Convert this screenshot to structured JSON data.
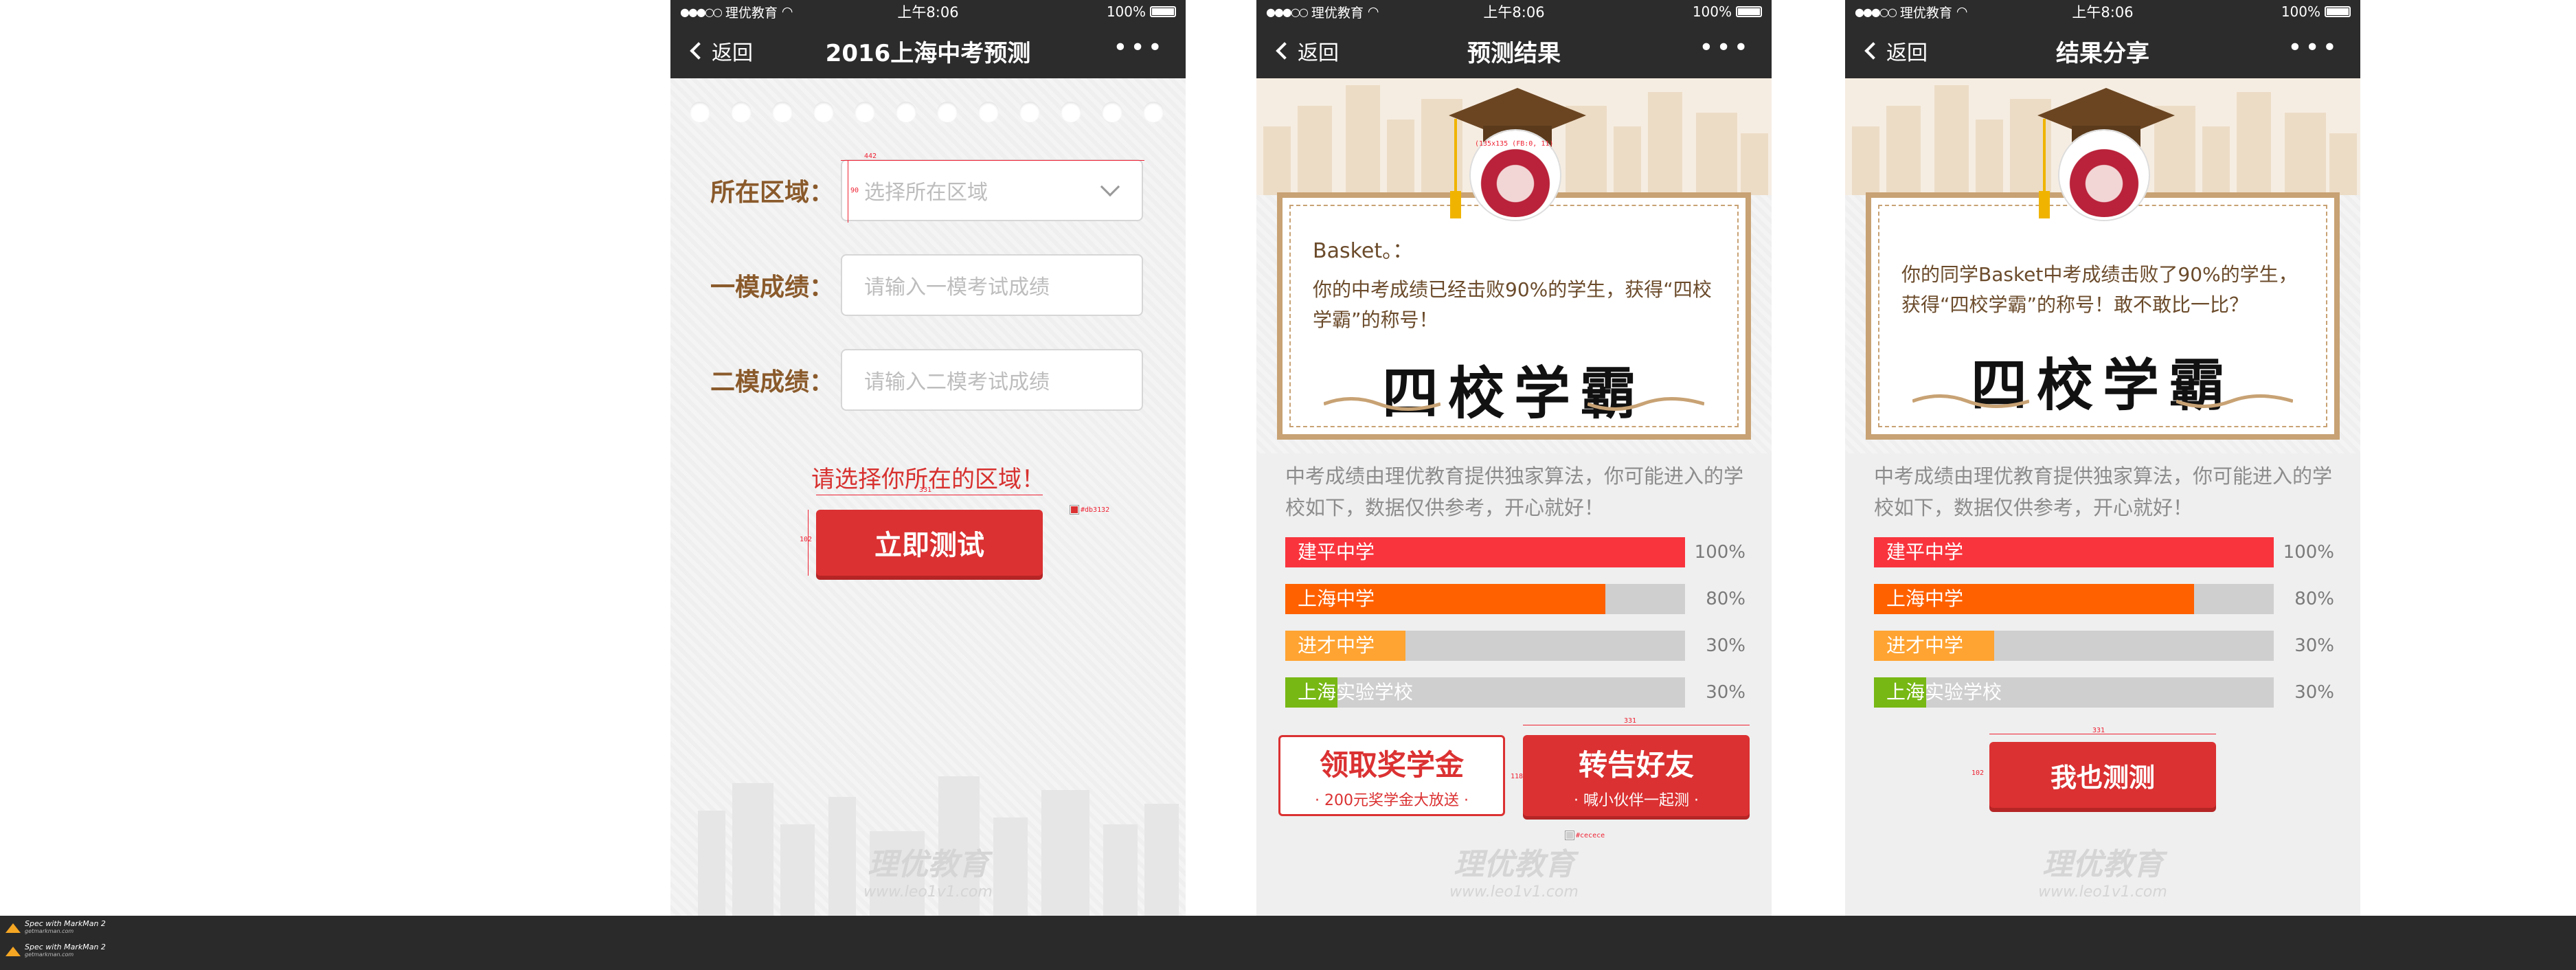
{
  "status": {
    "carrier": "理优教育",
    "time": "上午8:06",
    "battery": "100%"
  },
  "nav": {
    "back_label": "返回",
    "more_label": "•••"
  },
  "screen1": {
    "title": "2016上海中考预测",
    "fields": [
      {
        "label": "所在区域：",
        "placeholder": "选择所在区域"
      },
      {
        "label": "一模成绩：",
        "placeholder": "请输入一模考试成绩"
      },
      {
        "label": "二模成绩：",
        "placeholder": "请输入二模考试成绩"
      }
    ],
    "error": "请选择你所在的区域！",
    "submit": "立即测试",
    "annotations": {
      "width442": "442",
      "height90": "90",
      "width331": "331",
      "height102": "102",
      "color": "#db3132",
      "avatar_size": "(135x135 (FB:0, 11)"
    }
  },
  "screen2": {
    "title": "预测结果",
    "name_line": "Basket。：",
    "body": "你的中考成绩已经击败90%的学生，获得“四校学霸”的称号！",
    "badge": "四校学霸",
    "intro": "中考成绩由理优教育提供独家算法，你可能进入的学校如下，数据仅供参考，开心就好！",
    "bars": [
      {
        "name": "建平中学",
        "pct": "100%",
        "value": 1.0,
        "color": "#f9343d"
      },
      {
        "name": "上海中学",
        "pct": "80%",
        "value": 0.8,
        "color": "#ff6100"
      },
      {
        "name": "进才中学",
        "pct": "30%",
        "value": 0.3,
        "color": "#ffa432"
      },
      {
        "name": "上海实验学校",
        "pct": "30%",
        "value": 0.13,
        "color": "#77b814"
      }
    ],
    "bar_colors": [
      "#f9343d",
      "#ff6100",
      "#ffa432",
      "#77b814"
    ],
    "btn_left_title": "领取奖学金",
    "btn_left_sub": "· 200元奖学金大放送 ·",
    "btn_right_title": "转告好友",
    "btn_right_sub": "· 喊小伙伴一起测 ·",
    "annotations": {
      "w331": "331",
      "h118": "118",
      "gray": "#cecece"
    }
  },
  "screen3": {
    "title": "结果分享",
    "body": "你的同学Basket中考成绩击败了90%的学生，获得“四校学霸”的称号！敢不敢比一比？",
    "badge": "四校学霸",
    "intro": "中考成绩由理优教育提供独家算法，你可能进入的学校如下，数据仅供参考，开心就好！",
    "bars": [
      {
        "name": "建平中学",
        "pct": "100%",
        "value": 1.0,
        "color": "#f9343d"
      },
      {
        "name": "上海中学",
        "pct": "80%",
        "value": 0.8,
        "color": "#ff6100"
      },
      {
        "name": "进才中学",
        "pct": "30%",
        "value": 0.3,
        "color": "#ffa432"
      },
      {
        "name": "上海实验学校",
        "pct": "30%",
        "value": 0.13,
        "color": "#77b814"
      }
    ],
    "button": "我也测测",
    "annotations": {
      "w331": "331",
      "h102": "102"
    }
  },
  "watermark": {
    "name": "理优教育",
    "url": "www.leo1v1.com"
  },
  "footer": {
    "markman1": "Spec with MarkMan 2",
    "markman1_sub": "getmarkman.com",
    "markman2": "Spec with MarkMan 2",
    "markman2_sub": "getmarkman.com"
  }
}
